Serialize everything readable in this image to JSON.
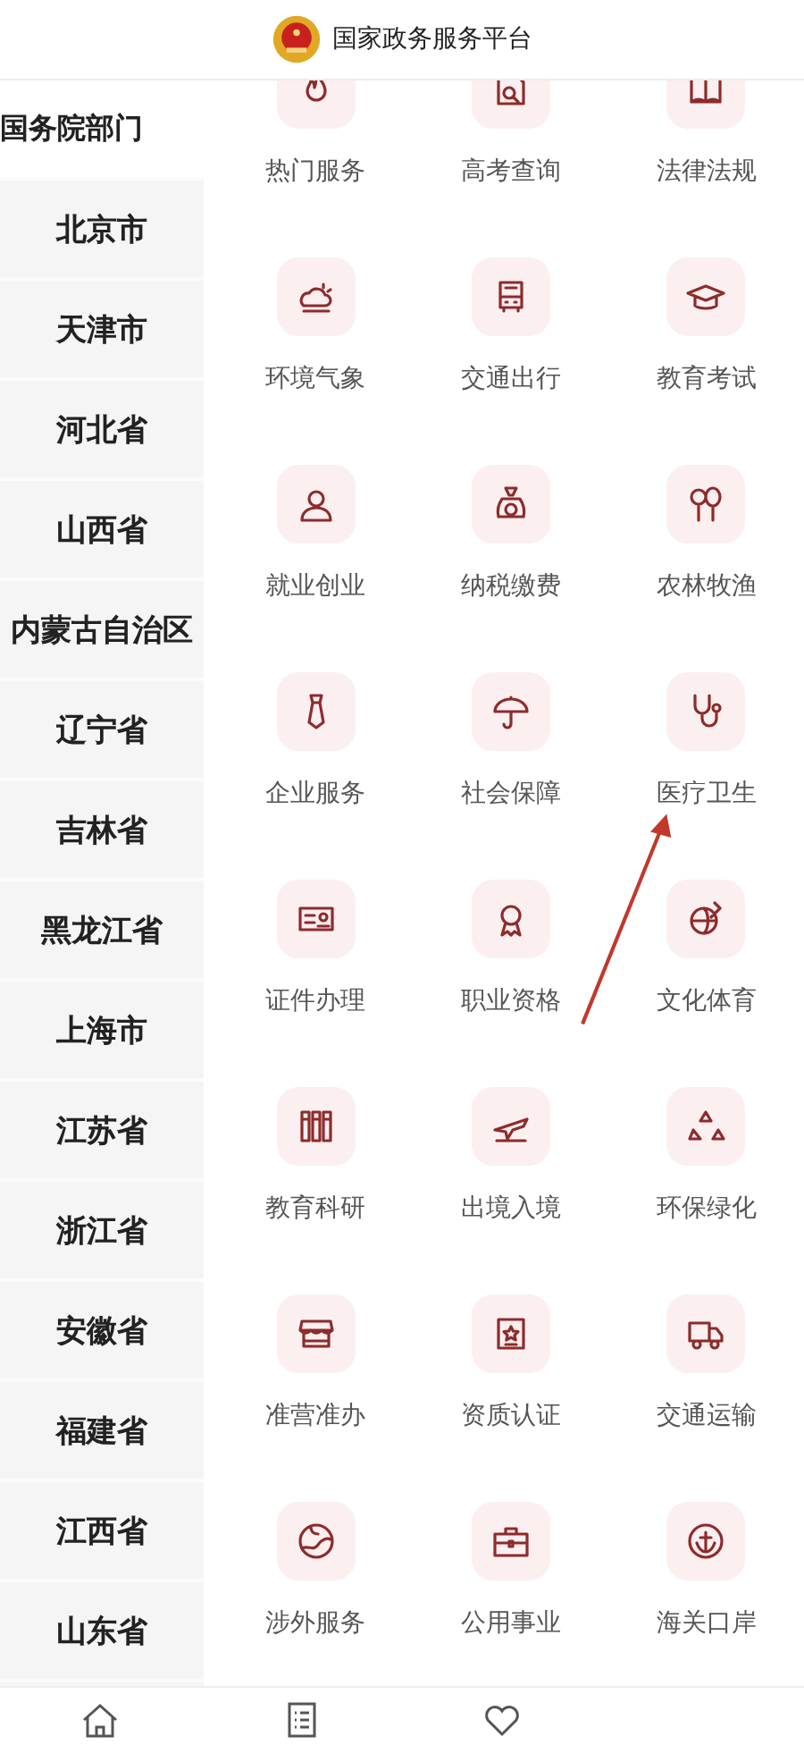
{
  "header": {
    "title": "国家政务服务平台"
  },
  "sidebar": {
    "items": [
      {
        "label": "国务院部门",
        "selected": true
      },
      {
        "label": "北京市",
        "selected": false
      },
      {
        "label": "天津市",
        "selected": false
      },
      {
        "label": "河北省",
        "selected": false
      },
      {
        "label": "山西省",
        "selected": false
      },
      {
        "label": "内蒙古自治区",
        "selected": false
      },
      {
        "label": "辽宁省",
        "selected": false
      },
      {
        "label": "吉林省",
        "selected": false
      },
      {
        "label": "黑龙江省",
        "selected": false
      },
      {
        "label": "上海市",
        "selected": false
      },
      {
        "label": "江苏省",
        "selected": false
      },
      {
        "label": "浙江省",
        "selected": false
      },
      {
        "label": "安徽省",
        "selected": false
      },
      {
        "label": "福建省",
        "selected": false
      },
      {
        "label": "江西省",
        "selected": false
      },
      {
        "label": "山东省",
        "selected": false
      }
    ]
  },
  "services": [
    {
      "label": "热门服务"
    },
    {
      "label": "高考查询"
    },
    {
      "label": "法律法规"
    },
    {
      "label": "环境气象"
    },
    {
      "label": "交通出行"
    },
    {
      "label": "教育考试"
    },
    {
      "label": "就业创业"
    },
    {
      "label": "纳税缴费"
    },
    {
      "label": "农林牧渔"
    },
    {
      "label": "企业服务"
    },
    {
      "label": "社会保障"
    },
    {
      "label": "医疗卫生"
    },
    {
      "label": "证件办理"
    },
    {
      "label": "职业资格"
    },
    {
      "label": "文化体育"
    },
    {
      "label": "教育科研"
    },
    {
      "label": "出境入境"
    },
    {
      "label": "环保绿化"
    },
    {
      "label": "准营准办"
    },
    {
      "label": "资质认证"
    },
    {
      "label": "交通运输"
    },
    {
      "label": "涉外服务"
    },
    {
      "label": "公用事业"
    },
    {
      "label": "海关口岸"
    }
  ]
}
